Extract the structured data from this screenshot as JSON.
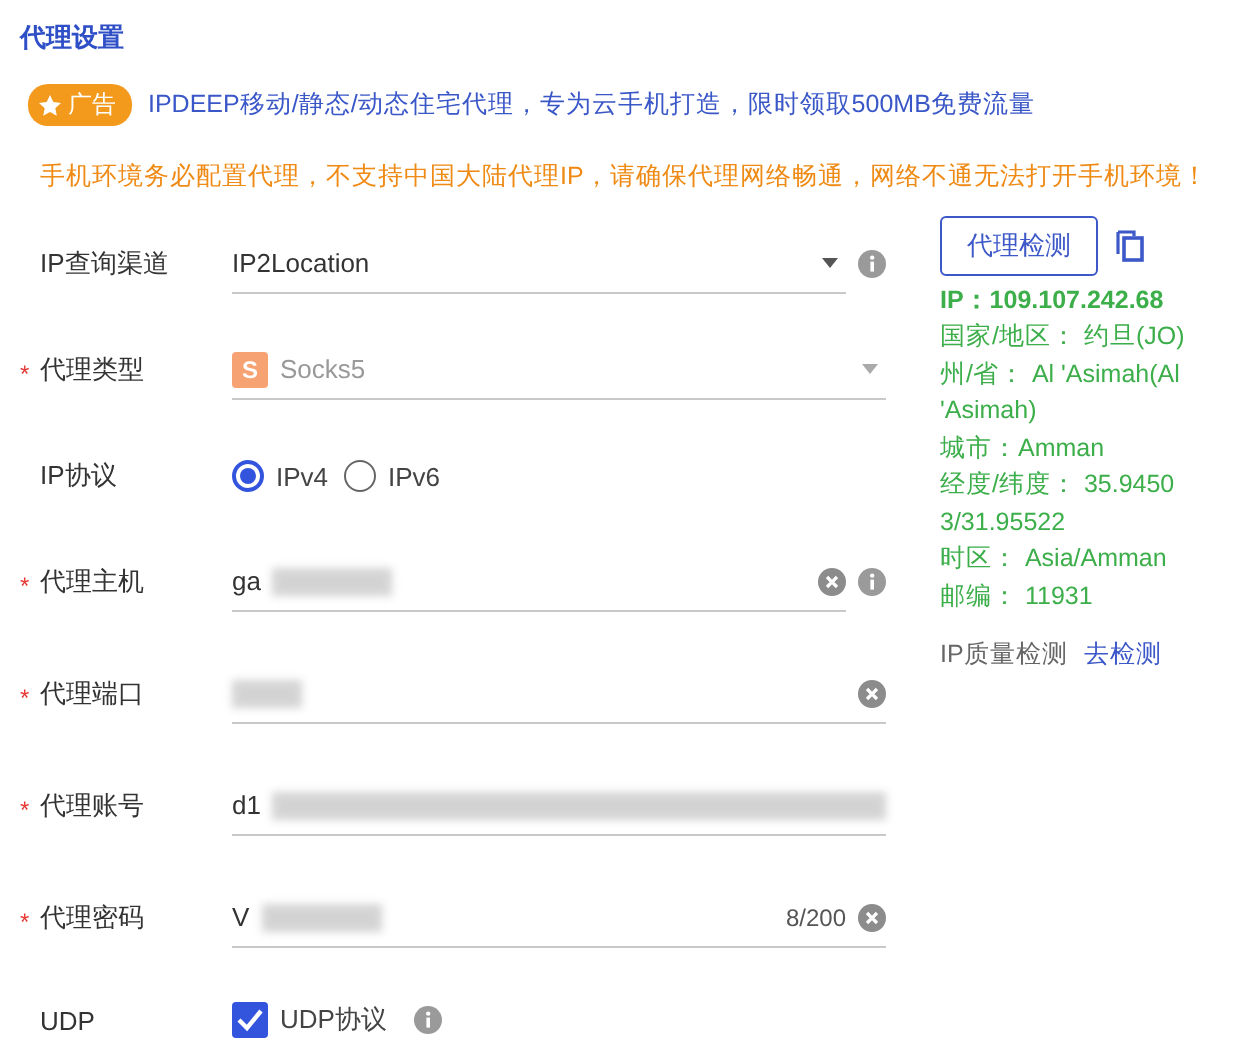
{
  "section_title": "代理设置",
  "ad": {
    "badge": "广告",
    "text": "IPDEEP移动/静态/动态住宅代理，专为云手机打造，限时领取500MB免费流量"
  },
  "warning": "手机环境务必配置代理，不支持中国大陆代理IP，请确保代理网络畅通，网络不通无法打开手机环境！",
  "fields": [
    {
      "kind": "select",
      "label": "IP查询渠道",
      "value": "IP2Location",
      "disabled": false,
      "info": true
    },
    {
      "kind": "select",
      "label": "代理类型",
      "required_mark": "*",
      "icon_letter": "S",
      "value": "Socks5",
      "disabled": true,
      "info": false
    },
    {
      "kind": "radio",
      "label": "IP协议",
      "options": [
        {
          "label": "IPv4",
          "selected": true
        },
        {
          "label": "IPv6",
          "selected": false
        }
      ]
    },
    {
      "kind": "text",
      "label": "代理主机",
      "required_mark": "*",
      "value": "ga",
      "redacted": true,
      "clearable": true,
      "info": true
    },
    {
      "kind": "text",
      "label": "代理端口",
      "required_mark": "*",
      "redacted": true,
      "clearable": true,
      "info": false
    },
    {
      "kind": "text",
      "label": "代理账号",
      "required_mark": "*",
      "value": "d1",
      "redacted": true,
      "clearable": false,
      "info": false
    },
    {
      "kind": "text",
      "label": "代理密码",
      "required_mark": "*",
      "value": "V",
      "redacted": true,
      "counter": "8/200",
      "clearable": true,
      "info": false
    },
    {
      "kind": "checkbox",
      "label": "UDP",
      "option": "UDP协议",
      "checked": true,
      "info": true
    }
  ],
  "check_button": "代理检测",
  "ip_result": {
    "ip": "IP：109.107.242.68",
    "lines": [
      "国家/地区： 约旦(JO)",
      "州/省：  Al 'Asimah(Al 'Asimah)",
      "城市：Amman",
      "经度/纬度： 35.94503/31.95522",
      "时区： Asia/Amman",
      "邮编： 11931"
    ]
  },
  "quality": {
    "label": "IP质量检测",
    "link": "去检测"
  }
}
